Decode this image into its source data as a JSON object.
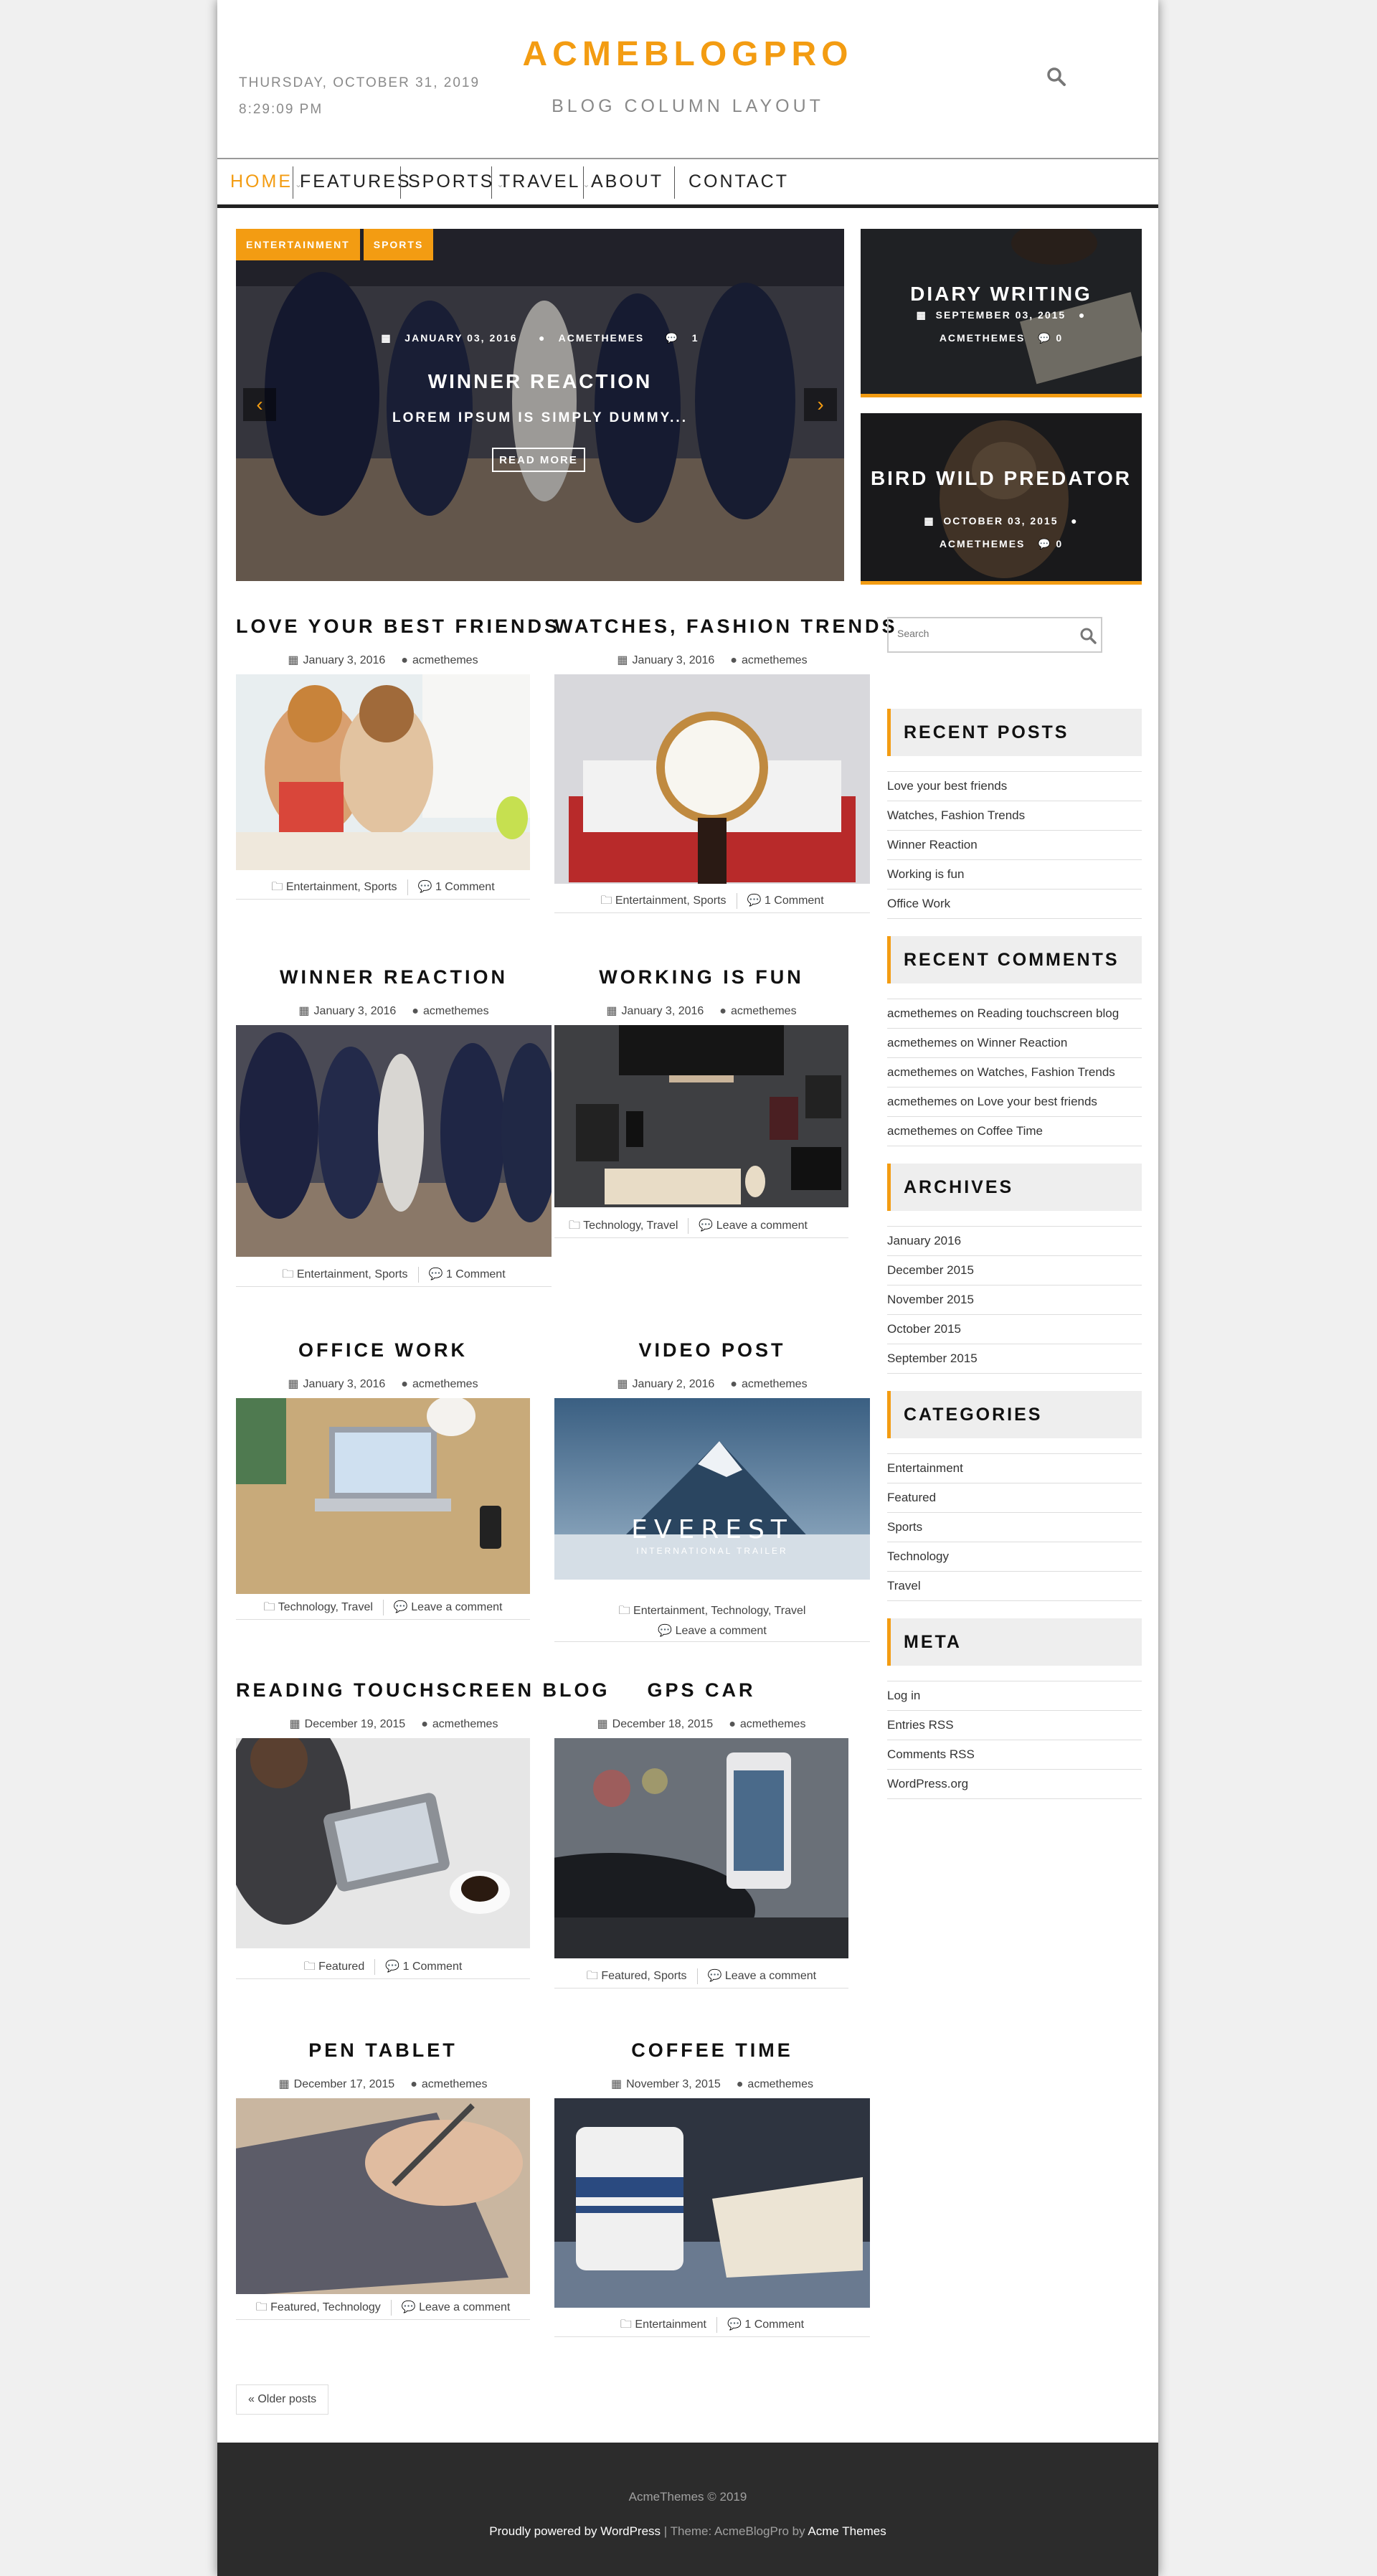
{
  "header": {
    "date": "THURSDAY, OCTOBER 31, 2019",
    "time": "8:29:09 PM",
    "site_title": "ACMEBLOGPRO",
    "site_description": "BLOG COLUMN LAYOUT",
    "search_icon": "search-icon"
  },
  "nav": {
    "items": [
      {
        "label": "HOME"
      },
      {
        "label": "FEATURES"
      },
      {
        "label": "SPORTS"
      },
      {
        "label": "TRAVEL"
      },
      {
        "label": "ABOUT"
      },
      {
        "label": "CONTACT"
      }
    ],
    "active": "HOME"
  },
  "slider": {
    "tags": [
      "ENTERTAINMENT",
      "SPORTS"
    ],
    "date": "JANUARY 03, 2016",
    "author": "ACMETHEMES",
    "comments": "1",
    "title": "WINNER REACTION",
    "excerpt": "LOREM IPSUM IS SIMPLY DUMMY...",
    "read_more": "READ MORE",
    "prev_icon": "chevron-left-icon",
    "next_icon": "chevron-right-icon"
  },
  "promos": [
    {
      "title": "DIARY WRITING",
      "date": "SEPTEMBER 03, 2015",
      "author": "ACMETHEMES",
      "comments": "0"
    },
    {
      "title": "BIRD WILD PREDATOR",
      "date": "OCTOBER 03, 2015",
      "author": "ACMETHEMES",
      "comments": "0"
    }
  ],
  "posts": [
    {
      "title": "LOVE YOUR BEST FRIENDS",
      "date": "January 3, 2016",
      "author": "acmethemes",
      "categories": "Entertainment, Sports",
      "comments": "1 Comment"
    },
    {
      "title": "WATCHES, FASHION TRENDS",
      "date": "January 3, 2016",
      "author": "acmethemes",
      "categories": "Entertainment, Sports",
      "comments": "1 Comment"
    },
    {
      "title": "WINNER REACTION",
      "date": "January 3, 2016",
      "author": "acmethemes",
      "categories": "Entertainment, Sports",
      "comments": "1 Comment"
    },
    {
      "title": "WORKING IS FUN",
      "date": "January 3, 2016",
      "author": "acmethemes",
      "categories": "Technology, Travel",
      "comments": "Leave a comment"
    },
    {
      "title": "OFFICE WORK",
      "date": "January 3, 2016",
      "author": "acmethemes",
      "categories": "Technology, Travel",
      "comments": "Leave a comment"
    },
    {
      "title": "VIDEO POST",
      "date": "January 2, 2016",
      "author": "acmethemes",
      "categories": "Entertainment, Technology, Travel",
      "comments": "Leave a comment"
    },
    {
      "title": "READING TOUCHSCREEN BLOG",
      "date": "December 19, 2015",
      "author": "acmethemes",
      "categories": "Featured",
      "comments": "1 Comment"
    },
    {
      "title": "GPS CAR",
      "date": "December 18, 2015",
      "author": "acmethemes",
      "categories": "Featured, Sports",
      "comments": "Leave a comment"
    },
    {
      "title": "PEN TABLET",
      "date": "December 17, 2015",
      "author": "acmethemes",
      "categories": "Featured, Technology",
      "comments": "Leave a comment"
    },
    {
      "title": "COFFEE TIME",
      "date": "November 3, 2015",
      "author": "acmethemes",
      "categories": "Entertainment",
      "comments": "1 Comment"
    }
  ],
  "video_post": {
    "overlay_title": "EVEREST",
    "overlay_subtitle": "INTERNATIONAL TRAILER"
  },
  "pagination": {
    "older": "Older posts"
  },
  "sidebar": {
    "search_placeholder": "Search",
    "recent_posts": {
      "title": "RECENT POSTS",
      "items": [
        "Love your best friends",
        "Watches, Fashion Trends",
        "Winner Reaction",
        "Working is fun",
        "Office Work"
      ]
    },
    "recent_comments": {
      "title": "RECENT COMMENTS",
      "items": [
        "acmethemes on Reading touchscreen blog",
        "acmethemes on Winner Reaction",
        "acmethemes on Watches, Fashion Trends",
        "acmethemes on Love your best friends",
        "acmethemes on Coffee Time"
      ]
    },
    "archives": {
      "title": "ARCHIVES",
      "items": [
        "January 2016",
        "December 2015",
        "November 2015",
        "October 2015",
        "September 2015"
      ]
    },
    "categories": {
      "title": "CATEGORIES",
      "items": [
        "Entertainment",
        "Featured",
        "Sports",
        "Technology",
        "Travel"
      ]
    },
    "meta": {
      "title": "META",
      "items": [
        "Log in",
        "Entries RSS",
        "Comments RSS",
        "WordPress.org"
      ]
    }
  },
  "footer": {
    "copyright": "AcmeThemes © 2019",
    "powered": "Proudly powered by WordPress",
    "sep": " | Theme: AcmeBlogPro by ",
    "theme_author": "Acme Themes"
  },
  "colors": {
    "accent": "#f39c12",
    "footer_bg": "#2c2c2c",
    "widget_bg": "#eeeeee"
  }
}
